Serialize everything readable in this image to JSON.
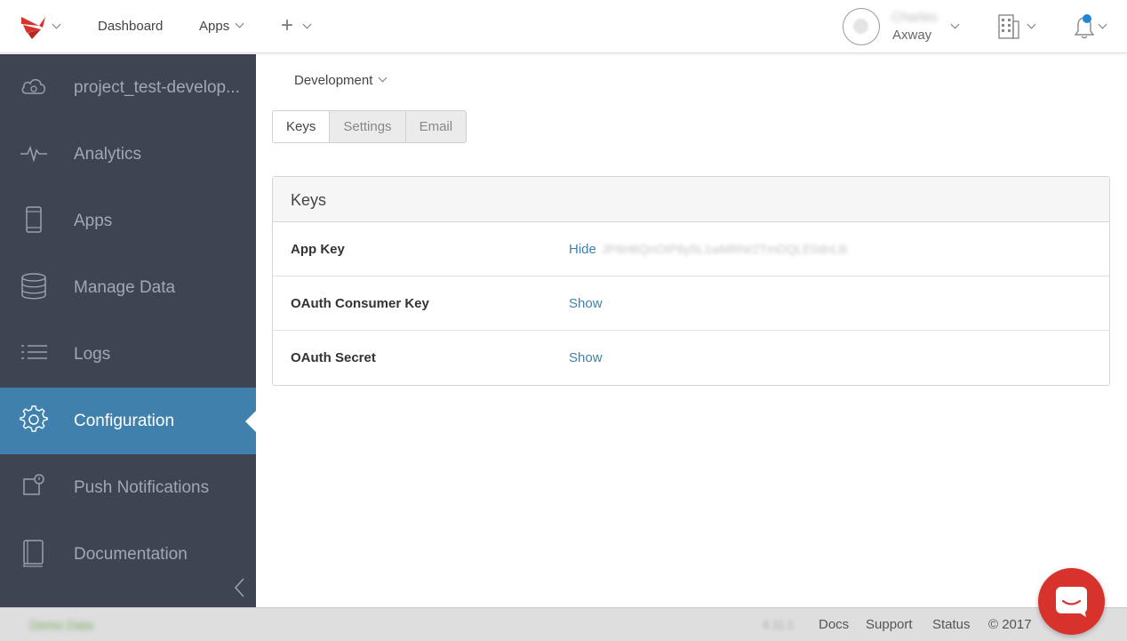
{
  "topbar": {
    "logo_icon": "axway-logo-icon",
    "nav": {
      "dashboard": "Dashboard",
      "apps": "Apps"
    },
    "user": {
      "name": "Charles",
      "org": "Axway"
    },
    "colors": {
      "notification_dot": "#1e88d8",
      "logo": "#d7322c"
    }
  },
  "sidebar": {
    "items": [
      {
        "label": "project_test-develop...",
        "icon": "cloud-icon"
      },
      {
        "label": "Analytics",
        "icon": "pulse-icon"
      },
      {
        "label": "Apps",
        "icon": "phone-icon"
      },
      {
        "label": "Manage Data",
        "icon": "database-icon"
      },
      {
        "label": "Logs",
        "icon": "list-icon"
      },
      {
        "label": "Configuration",
        "icon": "gear-icon",
        "active": true
      },
      {
        "label": "Push Notifications",
        "icon": "push-icon"
      },
      {
        "label": "Documentation",
        "icon": "book-icon"
      }
    ],
    "colors": {
      "background": "#3e4452",
      "active": "#3f80ad"
    }
  },
  "main": {
    "environment": "Development",
    "tabs": [
      {
        "label": "Keys",
        "active": true
      },
      {
        "label": "Settings"
      },
      {
        "label": "Email"
      }
    ],
    "panel": {
      "title": "Keys",
      "rows": [
        {
          "name": "App Key",
          "action": "Hide",
          "value": "JP6H6QnOIP6y5L1wMRNr2TmDQLE0dnLB"
        },
        {
          "name": "OAuth Consumer Key",
          "action": "Show"
        },
        {
          "name": "OAuth Secret",
          "action": "Show"
        }
      ]
    }
  },
  "footer": {
    "left": "Demo Data",
    "version": "4.11.1",
    "links": {
      "docs": "Docs",
      "support": "Support",
      "status": "Status"
    },
    "copyright": "© 2017"
  },
  "chat": {
    "icon": "chat-icon",
    "color": "#d7322c"
  }
}
